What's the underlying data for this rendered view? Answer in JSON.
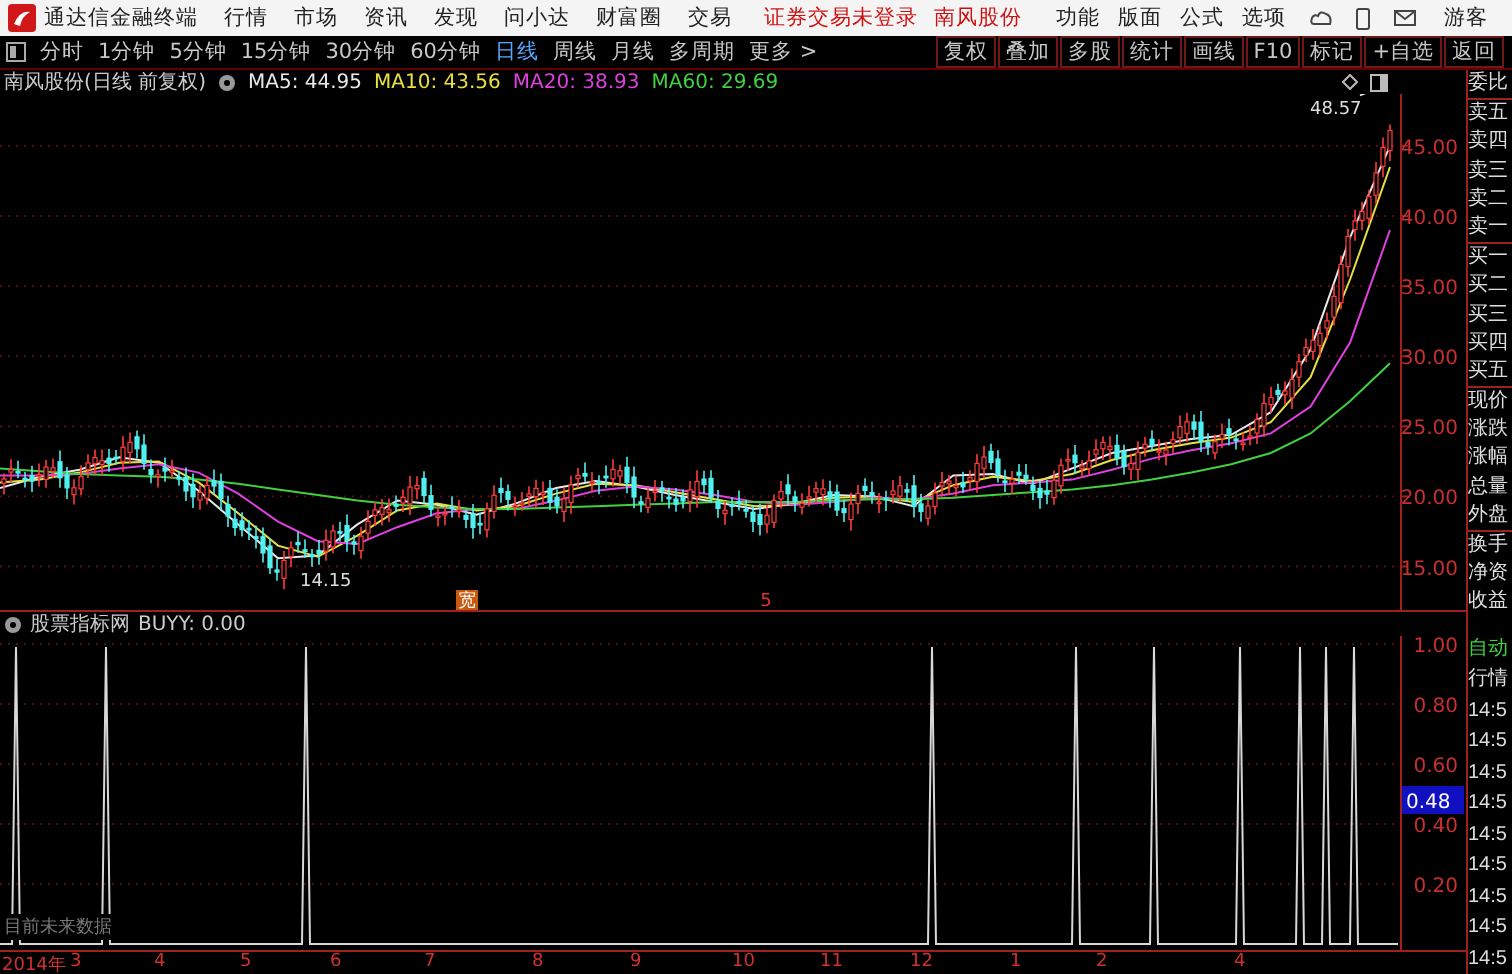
{
  "title_bar": {
    "app_name": "通达信金融终端",
    "menu": [
      "行情",
      "市场",
      "资讯",
      "发现",
      "问小达",
      "财富圈",
      "交易"
    ],
    "notice": "证券交易未登录",
    "stock_link": "南风股份",
    "right_menu": [
      "功能",
      "版面",
      "公式",
      "选项"
    ],
    "user": "游客"
  },
  "toolbar": {
    "periods": [
      {
        "label": "分时",
        "selected": false
      },
      {
        "label": "1分钟",
        "selected": false
      },
      {
        "label": "5分钟",
        "selected": false
      },
      {
        "label": "15分钟",
        "selected": false
      },
      {
        "label": "30分钟",
        "selected": false
      },
      {
        "label": "60分钟",
        "selected": false
      },
      {
        "label": "日线",
        "selected": true
      },
      {
        "label": "周线",
        "selected": false
      },
      {
        "label": "月线",
        "selected": false
      },
      {
        "label": "多周期",
        "selected": false
      },
      {
        "label": "更多 >",
        "selected": false
      }
    ],
    "buttons": [
      "复权",
      "叠加",
      "多股",
      "统计",
      "画线",
      "F10",
      "标记",
      "+自选",
      "返回"
    ]
  },
  "main_chart": {
    "title": "南风股份(日线 前复权)",
    "ma": [
      {
        "label": "MA5: 44.95",
        "color": "#e8e8e8"
      },
      {
        "label": "MA10: 43.56",
        "color": "#e8e040"
      },
      {
        "label": "MA20: 38.93",
        "color": "#e040e0"
      },
      {
        "label": "MA60: 29.69",
        "color": "#40d040"
      }
    ],
    "high_label": "48.57",
    "low_label": "14.15",
    "markers": [
      "宽",
      "5"
    ],
    "chart_data": {
      "type": "line",
      "ylim": [
        11.9,
        48.7
      ],
      "grid": true,
      "yticks": [
        {
          "value": 45,
          "label": "45.00"
        },
        {
          "value": 40,
          "label": "40.00"
        },
        {
          "value": 35,
          "label": "35.00"
        },
        {
          "value": 30,
          "label": "30.00"
        },
        {
          "value": 25,
          "label": "25.00"
        },
        {
          "value": 20,
          "label": "20.00"
        },
        {
          "value": 15,
          "label": "15.00"
        }
      ],
      "series": [
        {
          "color": "#e8e8e8",
          "values": [
            20.6,
            21.4,
            21.9,
            22.8,
            22.4,
            20.4,
            18,
            15.6,
            15.8,
            18,
            19.7,
            19.4,
            18.7,
            19.5,
            20.6,
            21.1,
            20.7,
            20.1,
            19.6,
            19.1,
            19.5,
            20.1,
            20,
            19.3,
            21.5,
            21.6,
            20.9,
            22,
            23.1,
            23.6,
            24.1,
            24.4,
            26,
            30.5,
            38.5,
            45
          ]
        },
        {
          "color": "#e8e040",
          "values": [
            21,
            21.2,
            21.7,
            22.4,
            22.5,
            21,
            18.8,
            16.5,
            15.7,
            17.2,
            19,
            19.5,
            19,
            19.3,
            20.2,
            20.9,
            20.8,
            20.3,
            19.8,
            19.3,
            19.4,
            19.9,
            20,
            19.6,
            20.8,
            21.4,
            21.1,
            21.6,
            22.6,
            23.3,
            23.8,
            24.2,
            25.3,
            28.5,
            35.5,
            43.5
          ]
        },
        {
          "color": "#e040e0",
          "values": [
            21.5,
            21.5,
            21.6,
            22,
            22.3,
            21.7,
            20.2,
            18.2,
            16.8,
            16.6,
            17.8,
            18.8,
            19.1,
            19.1,
            19.7,
            20.4,
            20.7,
            20.5,
            20.1,
            19.6,
            19.4,
            19.6,
            19.9,
            19.8,
            20.2,
            20.8,
            21,
            21.2,
            21.9,
            22.7,
            23.3,
            23.8,
            24.5,
            26.4,
            31,
            39
          ]
        },
        {
          "color": "#40d040",
          "values": [
            22,
            21.8,
            21.6,
            21.5,
            21.4,
            21.2,
            20.9,
            20.5,
            20.1,
            19.7,
            19.4,
            19.2,
            19.1,
            19.1,
            19.2,
            19.3,
            19.4,
            19.5,
            19.6,
            19.6,
            19.6,
            19.7,
            19.8,
            19.8,
            19.9,
            20.1,
            20.3,
            20.5,
            20.8,
            21.2,
            21.7,
            22.3,
            23.1,
            24.5,
            26.8,
            29.5
          ]
        }
      ]
    }
  },
  "quote_panel": {
    "labels": [
      "委比",
      "卖五",
      "卖四",
      "卖三",
      "卖二",
      "卖一",
      "买一",
      "买二",
      "买三",
      "买四",
      "买五",
      "现价",
      "涨跌",
      "涨幅",
      "总量",
      "外盘",
      "换手",
      "净资",
      "收益"
    ]
  },
  "indicator": {
    "title": "股票指标网",
    "value": "BUYY: 0.00",
    "y_labels": [
      "1.00",
      "0.80",
      "0.60",
      "0.40",
      "0.20"
    ],
    "cursor_value": "0.48",
    "note": "目前未来数据"
  },
  "time_list": {
    "mode": "自动",
    "label": "行情",
    "times": [
      "14:5",
      "14:5",
      "14:5",
      "14:5",
      "14:5",
      "14:5",
      "14:5",
      "14:5",
      "14:5"
    ]
  },
  "x_axis": [
    "2014年",
    "3",
    "4",
    "5",
    "6",
    "7",
    "8",
    "9",
    "10",
    "11",
    "12",
    "1",
    "2",
    "4"
  ]
}
